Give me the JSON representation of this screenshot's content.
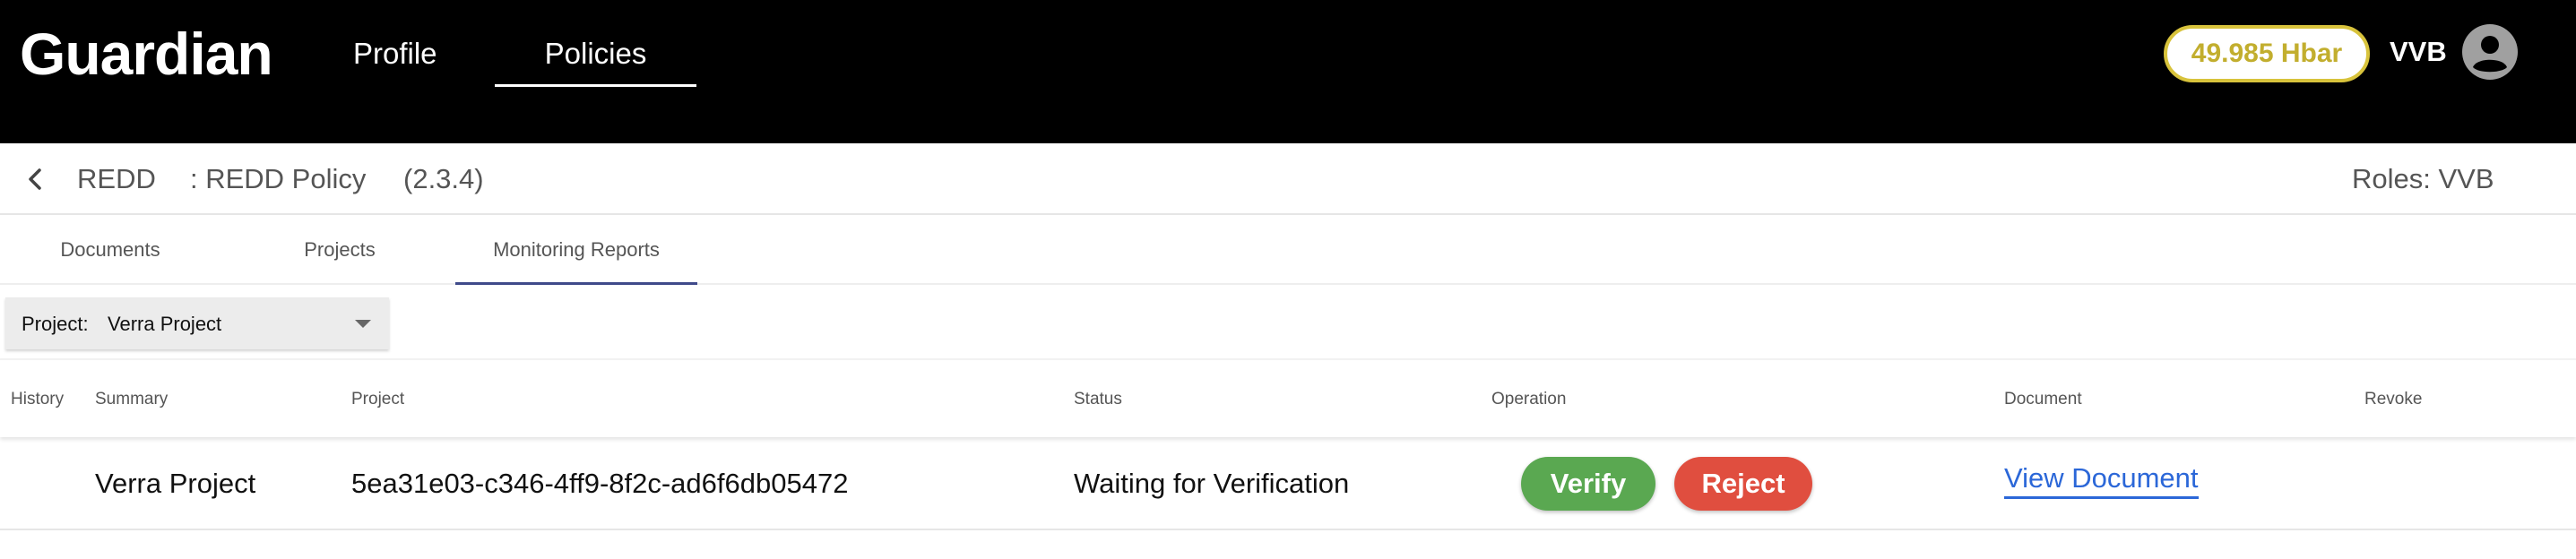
{
  "header": {
    "logo": "Guardian",
    "nav": [
      {
        "label": "Profile",
        "active": false
      },
      {
        "label": "Policies",
        "active": true
      }
    ],
    "balance": "49.985 Hbar",
    "username": "VVB",
    "avatar_icon": "account-circle-icon"
  },
  "policy": {
    "back_icon": "chevron-left-icon",
    "short_name": "REDD",
    "name": ": REDD Policy",
    "version": "(2.3.4)",
    "roles": "Roles: VVB"
  },
  "tabs": [
    {
      "label": "Documents",
      "active": false
    },
    {
      "label": "Projects",
      "active": false
    },
    {
      "label": "Monitoring Reports",
      "active": true
    }
  ],
  "filter": {
    "label": "Project:",
    "value": "Verra Project"
  },
  "table": {
    "columns": [
      "History",
      "Summary",
      "Project",
      "Status",
      "Operation",
      "Document",
      "Revoke"
    ],
    "rows": [
      {
        "history": "",
        "summary": "Verra Project",
        "project": "5ea31e03-c346-4ff9-8f2c-ad6f6db05472",
        "status": "Waiting for Verification",
        "operations": {
          "verify": "Verify",
          "reject": "Reject"
        },
        "document": "View Document",
        "revoke": ""
      }
    ]
  },
  "colors": {
    "header_bg": "#000000",
    "balance_border": "#d8c33c",
    "balance_text": "#c2ae2e",
    "tab_active_underline": "#3f4a8a",
    "verify_button": "#5aa851",
    "reject_button": "#e04e3f",
    "link": "#2b67d8"
  }
}
